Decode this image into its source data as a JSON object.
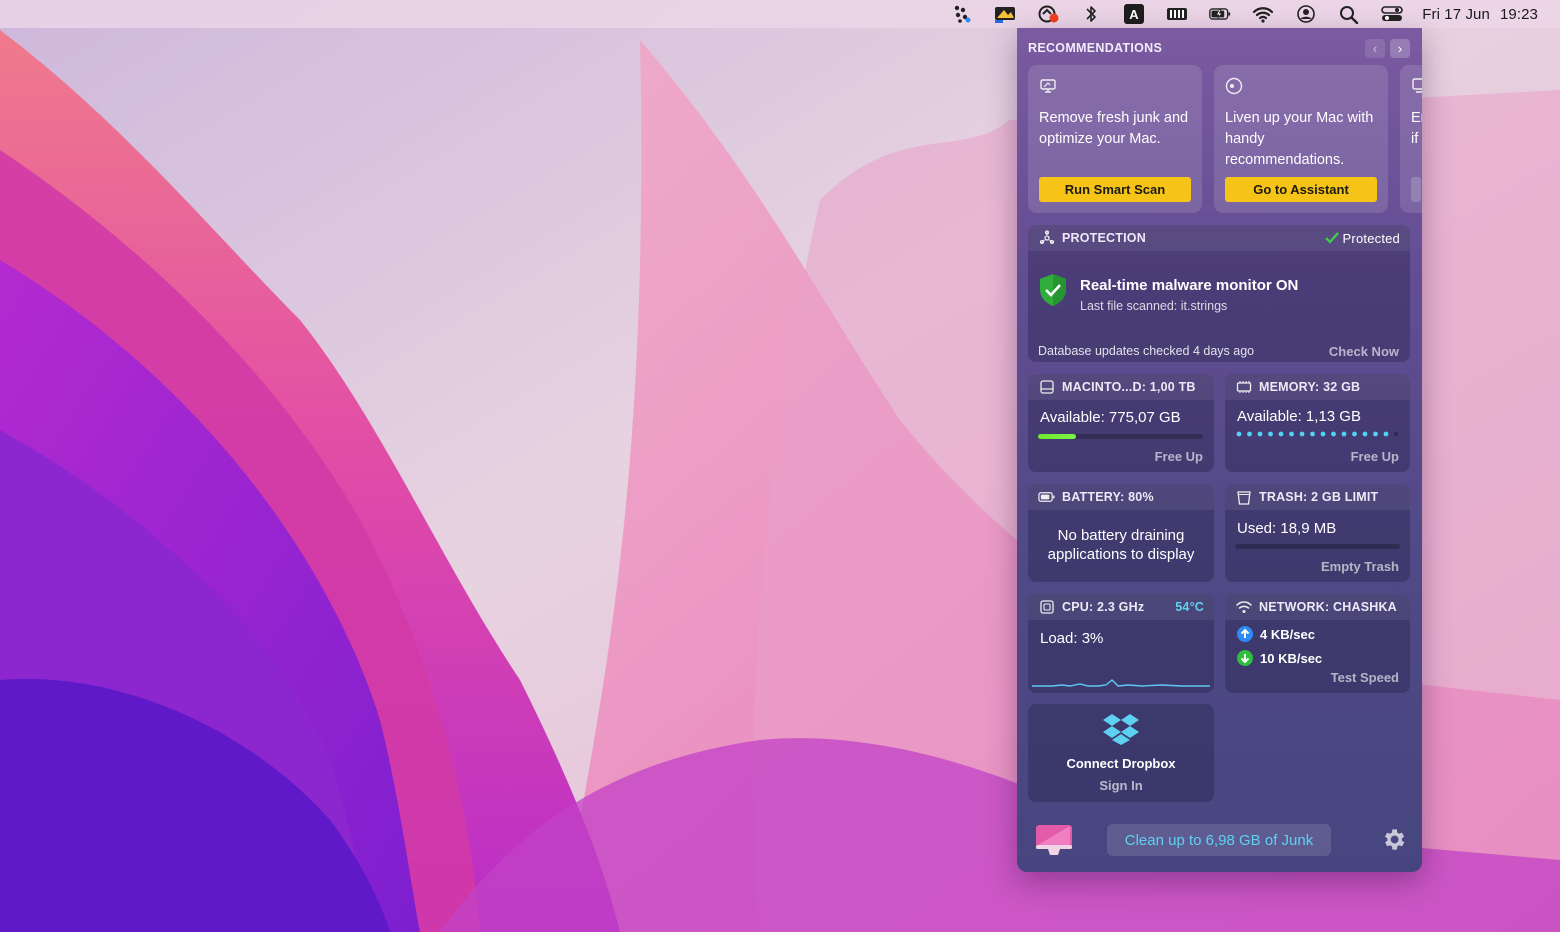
{
  "menubar": {
    "icons": [
      "cleanmymac-menu-icon",
      "screen-icon",
      "cloud-sync-icon",
      "bluetooth-icon",
      "keyboard-input-icon",
      "memory-icon",
      "battery-icon",
      "wifi-icon",
      "user-icon",
      "spotlight-icon",
      "control-center-icon"
    ],
    "input_source_label": "A",
    "date": "Fri 17 Jun",
    "time": "19:23"
  },
  "recommendations": {
    "title": "RECOMMENDATIONS",
    "cards": [
      {
        "icon": "monitor-clean-icon",
        "text": "Remove fresh junk and optimize your Mac.",
        "button": "Run Smart Scan"
      },
      {
        "icon": "assistant-icon",
        "text": "Liven up your Mac with handy recommendations.",
        "button": "Go to Assistant"
      },
      {
        "icon": "partial-card-icon",
        "text": "Er if",
        "button": ""
      }
    ]
  },
  "protection": {
    "title": "PROTECTION",
    "status": "Protected",
    "monitor_title": "Real-time malware monitor ON",
    "last_scanned": "Last file scanned: it.strings",
    "db_status": "Database updates checked 4 days ago",
    "action": "Check Now"
  },
  "disk": {
    "title": "MACINTO...D: 1,00 TB",
    "available": "Available: 775,07 GB",
    "used_fraction": 0.23,
    "action": "Free Up"
  },
  "memory": {
    "title": "MEMORY: 32 GB",
    "available": "Available: 1,13 GB",
    "action": "Free Up"
  },
  "battery": {
    "title": "BATTERY: 80%",
    "message": "No battery draining applications to display"
  },
  "trash": {
    "title": "TRASH: 2 GB LIMIT",
    "used": "Used: 18,9 MB",
    "action": "Empty Trash"
  },
  "cpu": {
    "title": "CPU: 2.3 GHz",
    "temp": "54°C",
    "load": "Load: 3%"
  },
  "network": {
    "title": "NETWORK: CHASHKA",
    "upload": "4 KB/sec",
    "download": "10 KB/sec",
    "action": "Test Speed"
  },
  "dropbox": {
    "title": "Connect Dropbox",
    "action": "Sign In"
  },
  "footer": {
    "clean_button": "Clean up to 6,98 GB of Junk"
  },
  "colors": {
    "accent_yellow": "#f6c417",
    "protected_green": "#3fcf45",
    "link_cyan": "#5fd1f0",
    "upload_blue": "#2c8bf5",
    "download_green": "#2fbf3d"
  }
}
